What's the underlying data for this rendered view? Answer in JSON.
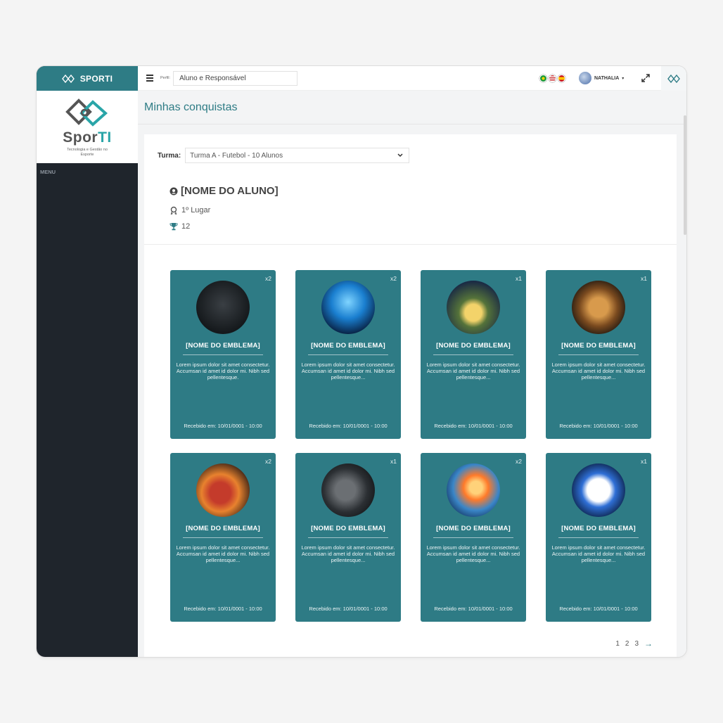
{
  "sidebar": {
    "app_name": "SPORTI",
    "brand_main": "Spor",
    "brand_accent": "TI",
    "tagline": "Tecnologia e Gestão no Esporte",
    "menu_label": "MENU"
  },
  "topbar": {
    "perfil_label": "Perfil:",
    "perfil_value": "Aluno e Responsável",
    "flags": [
      "flag-brazil-icon",
      "flag-usa-icon",
      "flag-spain-icon"
    ],
    "user_name": "NATHALIA",
    "user_caret": "▾"
  },
  "page": {
    "title": "Minhas conquistas",
    "turma_label": "Turma:",
    "turma_value": "Turma A - Futebol - 10 Alunos",
    "student_name": "[NOME DO ALUNO]",
    "ranking": "1º Lugar",
    "trophies": "12"
  },
  "cards": [
    {
      "count": "x2",
      "badge": "trophy",
      "name": "[NOME DO EMBLEMA]",
      "desc": "Lorem ipsum dolor sit amet consectetur. Accumsan id amet id dolor mi. Nibh sed pellentesque.",
      "date": "Recebido em: 10/01/0001 - 10:00"
    },
    {
      "count": "x2",
      "badge": "players",
      "name": "[NOME DO EMBLEMA]",
      "desc": "Lorem ipsum dolor sit amet consectetur. Accumsan id amet id dolor mi. Nibh sed pellentesque...",
      "date": "Recebido em: 10/01/0001 - 10:00"
    },
    {
      "count": "x1",
      "badge": "stadium",
      "name": "[NOME DO EMBLEMA]",
      "desc": "Lorem ipsum dolor sit amet consectetur. Accumsan id amet id dolor mi. Nibh sed pellentesque...",
      "date": "Recebido em: 10/01/0001 - 10:00"
    },
    {
      "count": "x1",
      "badge": "lion",
      "name": "[NOME DO EMBLEMA]",
      "desc": "Lorem ipsum dolor sit amet consectetur. Accumsan id amet id dolor mi. Nibh sed pellentesque...",
      "date": "Recebido em: 10/01/0001 - 10:00"
    },
    {
      "count": "x2",
      "badge": "boot",
      "name": "[NOME DO EMBLEMA]",
      "desc": "Lorem ipsum dolor sit amet consectetur. Accumsan id amet id dolor mi. Nibh sed pellentesque...",
      "date": "Recebido em: 10/01/0001 - 10:00"
    },
    {
      "count": "x1",
      "badge": "whistle",
      "name": "[NOME DO EMBLEMA]",
      "desc": "Lorem ipsum dolor sit amet consectetur. Accumsan id amet id dolor mi. Nibh sed pellentesque...",
      "date": "Recebido em: 10/01/0001 - 10:00"
    },
    {
      "count": "x2",
      "badge": "flame",
      "name": "[NOME DO EMBLEMA]",
      "desc": "Lorem ipsum dolor sit amet consectetur. Accumsan id amet id dolor mi. Nibh sed pellentesque...",
      "date": "Recebido em: 10/01/0001 - 10:00"
    },
    {
      "count": "x1",
      "badge": "ball",
      "name": "[NOME DO EMBLEMA]",
      "desc": "Lorem ipsum dolor sit amet consectetur. Accumsan id amet id dolor mi. Nibh sed pellentesque...",
      "date": "Recebido em: 10/01/0001 - 10:00"
    }
  ],
  "pagination": {
    "pages": [
      "1",
      "2",
      "3"
    ],
    "next": "→"
  },
  "colors": {
    "accent": "#2e7c85",
    "card": "#2e7b85",
    "sidebar": "#1f252c"
  }
}
